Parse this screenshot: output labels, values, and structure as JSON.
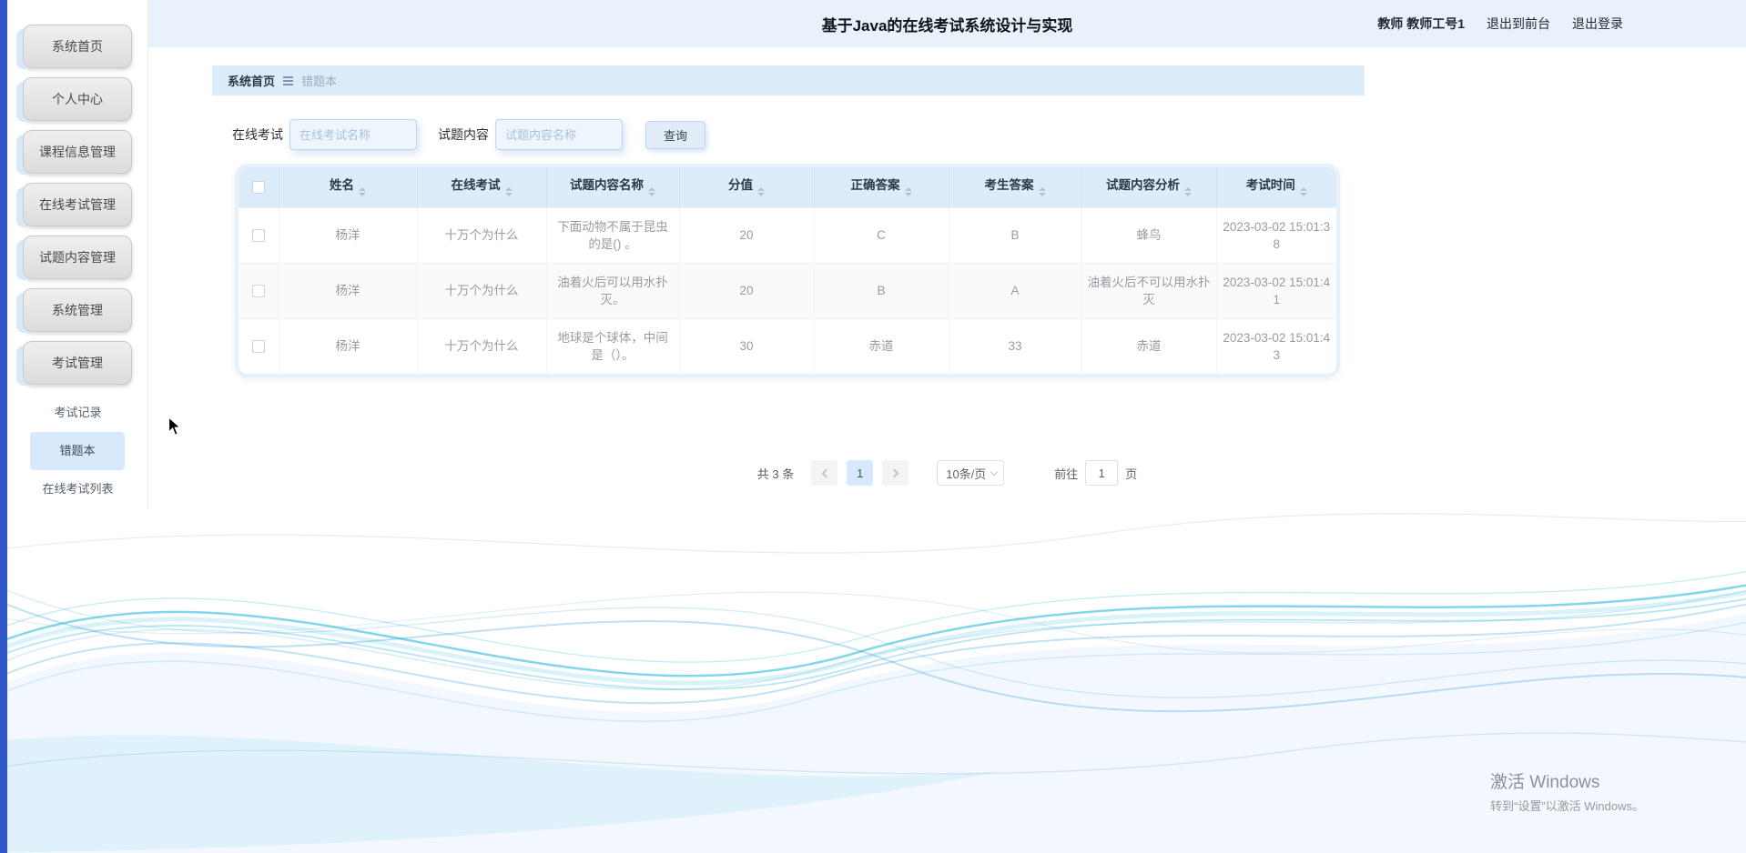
{
  "app": {
    "title": "基于Java的在线考试系统设计与实现"
  },
  "header": {
    "user": "教师 教师工号1",
    "exit_front": "退出到前台",
    "logout": "退出登录"
  },
  "sidebar": {
    "items": [
      "系统首页",
      "个人中心",
      "课程信息管理",
      "在线考试管理",
      "试题内容管理",
      "系统管理",
      "考试管理"
    ],
    "submenu": [
      "考试记录",
      "错题本",
      "在线考试列表"
    ],
    "active_submenu": "错题本"
  },
  "breadcrumb": {
    "home": "系统首页",
    "current": "错题本"
  },
  "filters": {
    "exam_label": "在线考试",
    "exam_placeholder": "在线考试名称",
    "question_label": "试题内容",
    "question_placeholder": "试题内容名称",
    "query_label": "查询"
  },
  "table": {
    "columns": [
      "姓名",
      "在线考试",
      "试题内容名称",
      "分值",
      "正确答案",
      "考生答案",
      "试题内容分析",
      "考试时间"
    ],
    "rows": [
      {
        "name": "杨洋",
        "exam": "十万个为什么",
        "question": "下面动物不属于昆虫的是() 。",
        "score": "20",
        "correct": "C",
        "answer": "B",
        "analysis": "蜂鸟",
        "time": "2023-03-02 15:01:38"
      },
      {
        "name": "杨洋",
        "exam": "十万个为什么",
        "question": "油着火后可以用水扑灭。",
        "score": "20",
        "correct": "B",
        "answer": "A",
        "analysis": "油着火后不可以用水扑灭",
        "time": "2023-03-02 15:01:41"
      },
      {
        "name": "杨洋",
        "exam": "十万个为什么",
        "question": "地球是个球体，中间是（）。",
        "score": "30",
        "correct": "赤道",
        "answer": "33",
        "analysis": "赤道",
        "time": "2023-03-02 15:01:43"
      }
    ]
  },
  "pagination": {
    "total": "共 3 条",
    "page": "1",
    "page_size": "10条/页",
    "goto_label": "前往",
    "goto_value": "1",
    "goto_suffix": "页"
  },
  "watermark": {
    "line1": "激活 Windows",
    "line2": "转到“设置”以激活 Windows。"
  },
  "colors": {
    "accent_blue": "#2e56c6",
    "header_bg": "#e9f1fb",
    "panel_blue": "#dcecfb",
    "wave_cyan": "#2ebade"
  }
}
